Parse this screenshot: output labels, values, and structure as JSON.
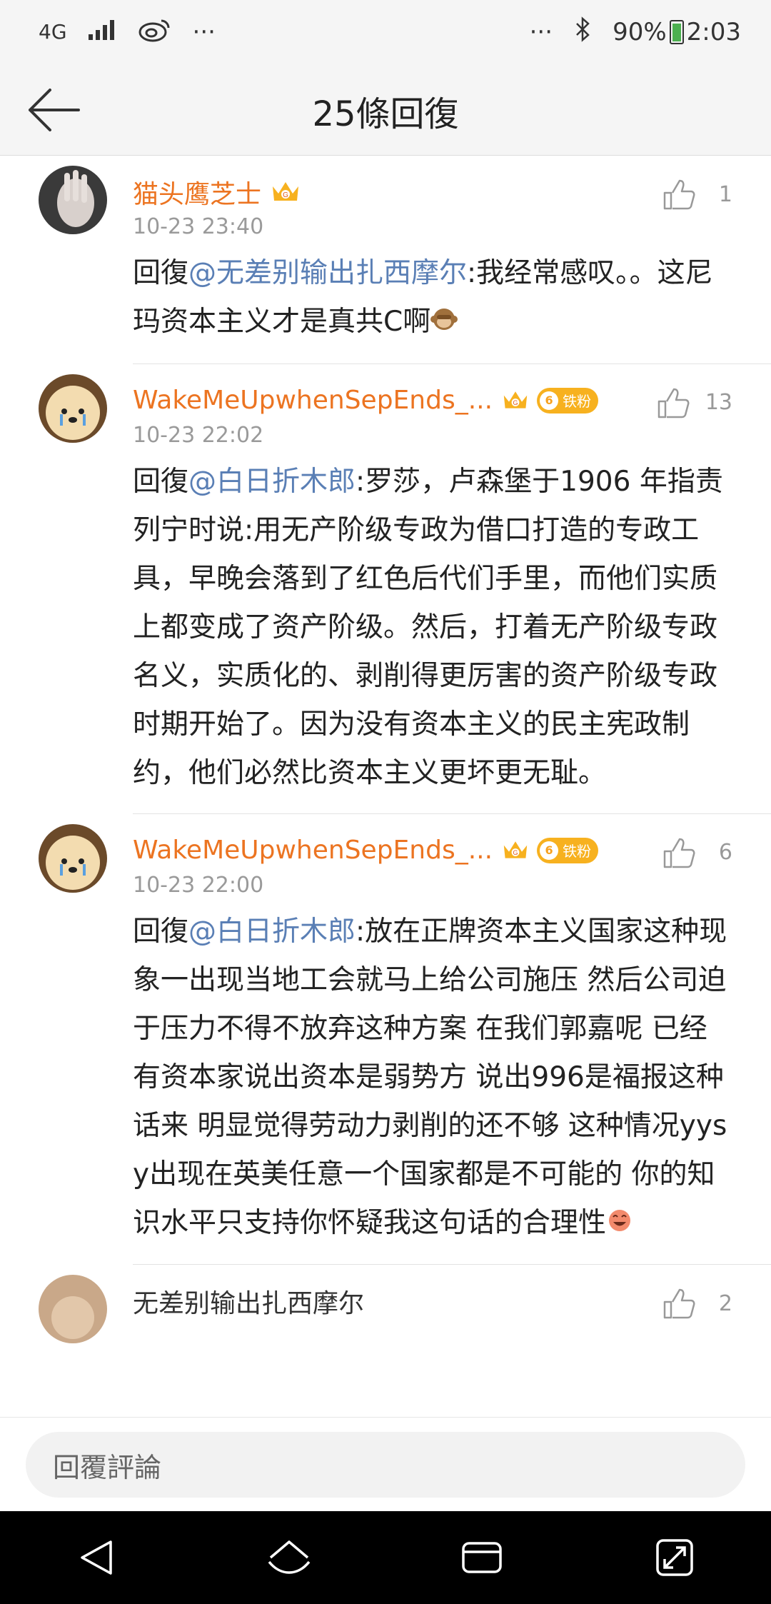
{
  "status_bar": {
    "network": "4G",
    "left_dots": "···",
    "right_dots": "···",
    "battery": "90%",
    "time": "2:03"
  },
  "header": {
    "title": "25條回復"
  },
  "comments": [
    {
      "name": "猫头鹰芝士",
      "badges": [
        "crown-vip"
      ],
      "likes": "1",
      "time": "10-23 23:40",
      "reply_prefix": "回復",
      "mention": "@无差别输出扎西摩尔",
      "text": ":我经常感叹。。这尼玛资本主义才是真共C啊",
      "emoji": "monkey-emoji"
    },
    {
      "name": "WakeMeUpwhenSepEnds_...",
      "badges": [
        "crown-vip",
        "fan-badge"
      ],
      "fan_badge_label": "铁粉",
      "fan_badge_level": "6",
      "likes": "13",
      "time": "10-23 22:02",
      "reply_prefix": "回復",
      "mention": "@白日折木郎",
      "text": ":罗莎，卢森堡于1906 年指责列宁时说:用无产阶级专政为借口打造的专政工具，早晚会落到了红色后代们手里，而他们实质上都变成了资产阶级。然后，打着无产阶级专政名义，实质化的、剥削得更厉害的资产阶级专政时期开始了。因为没有资本主义的民主宪政制约，他们必然比资本主义更坏更无耻。"
    },
    {
      "name": "WakeMeUpwhenSepEnds_...",
      "badges": [
        "crown-vip",
        "fan-badge"
      ],
      "fan_badge_label": "铁粉",
      "fan_badge_level": "6",
      "likes": "6",
      "time": "10-23 22:00",
      "reply_prefix": "回復",
      "mention": "@白日折木郎",
      "text": ":放在正牌资本主义国家这种现象一出现当地工会就马上给公司施压 然后公司迫于压力不得不放弃这种方案 在我们郭嘉呢 已经有资本家说出资本是弱势方 说出996是福报这种话来 明显觉得劳动力剥削的还不够 这种情况yysy出现在英美任意一个国家都是不可能的 你的知识水平只支持你怀疑我这句话的合理性",
      "emoji": "laugh-emoji"
    },
    {
      "name": "无差别输出扎西摩尔",
      "likes": "2"
    }
  ],
  "reply_bar": {
    "placeholder": "回覆評論"
  },
  "colors": {
    "username": "#ec7421",
    "mention": "#5a7fb5",
    "timestamp": "#9a9a9a",
    "badge": "#f7b11f"
  }
}
